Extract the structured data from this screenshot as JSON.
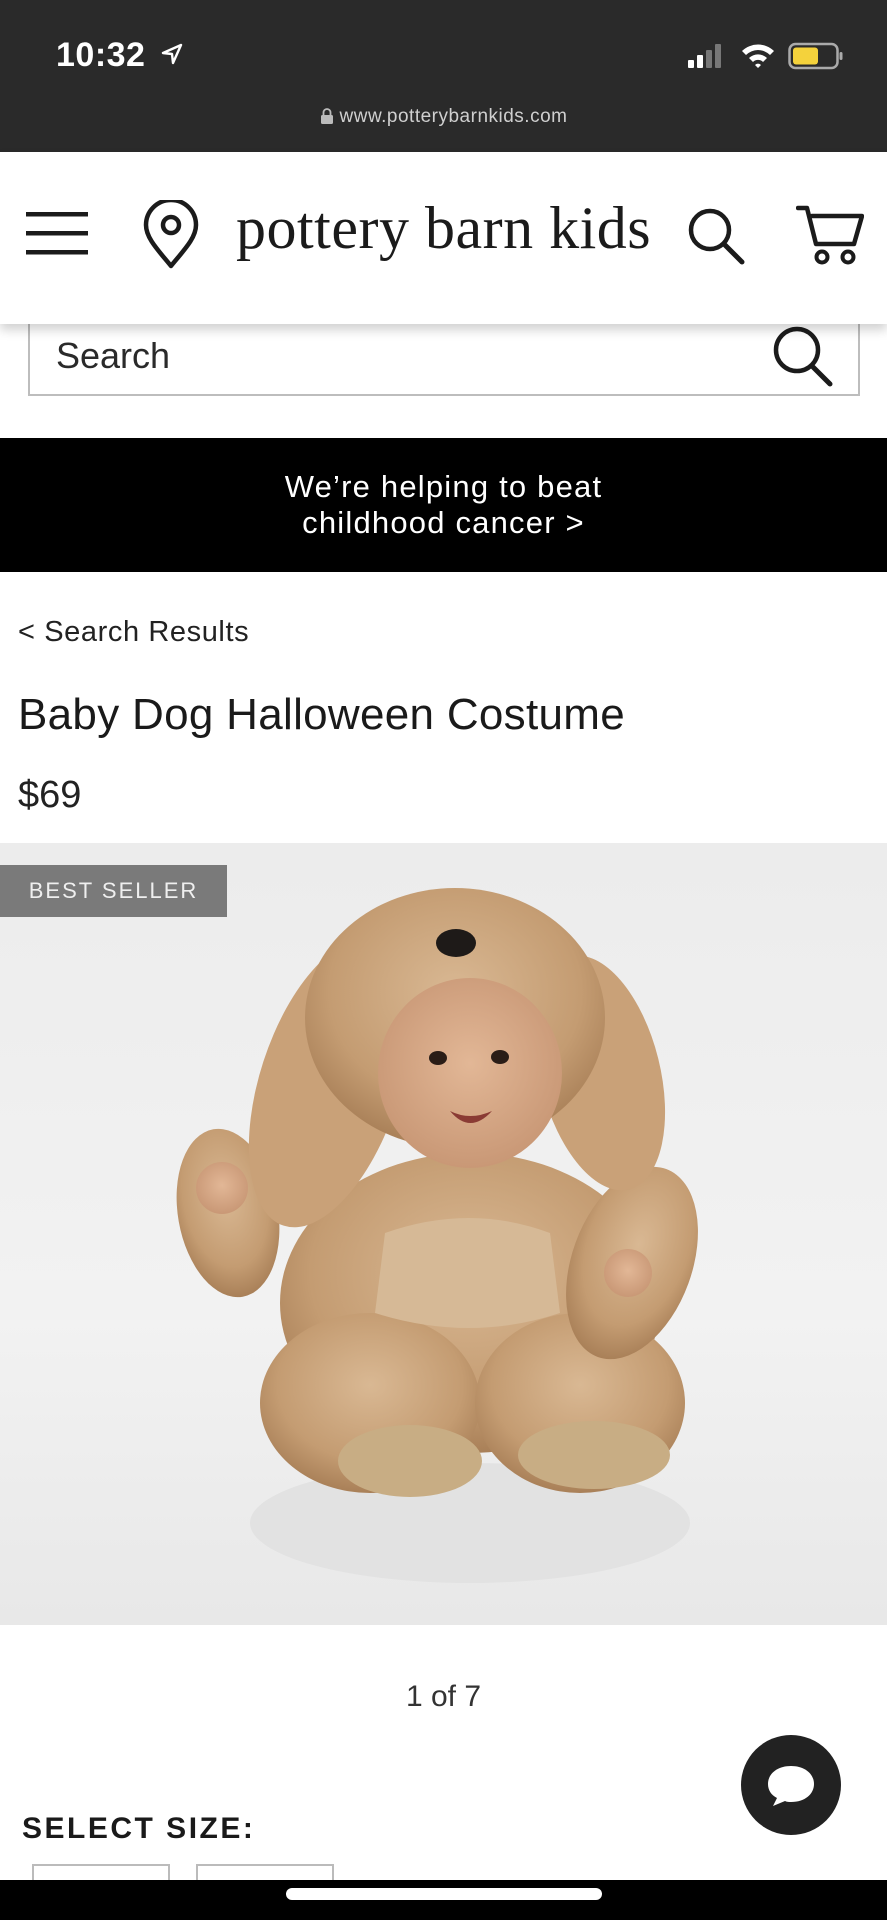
{
  "status_bar": {
    "time": "10:32",
    "url": "www.potterybarnkids.com"
  },
  "header": {
    "logo": "pottery barn kids"
  },
  "search": {
    "placeholder": "Search"
  },
  "promo": {
    "text": "We’re helping to beat childhood cancer >"
  },
  "product": {
    "back_link": "< Search Results",
    "title": "Baby Dog Halloween Costume",
    "price": "$69",
    "badge": "BEST SELLER",
    "pager": "1 of 7"
  },
  "size_section": {
    "label": "SELECT SIZE:"
  },
  "colors": {
    "status_bg": "#2a2a2a",
    "promo_bg": "#000000",
    "badge_bg": "#7a7a7a",
    "chat_bg": "#222222",
    "battery": "#f4d23c"
  }
}
